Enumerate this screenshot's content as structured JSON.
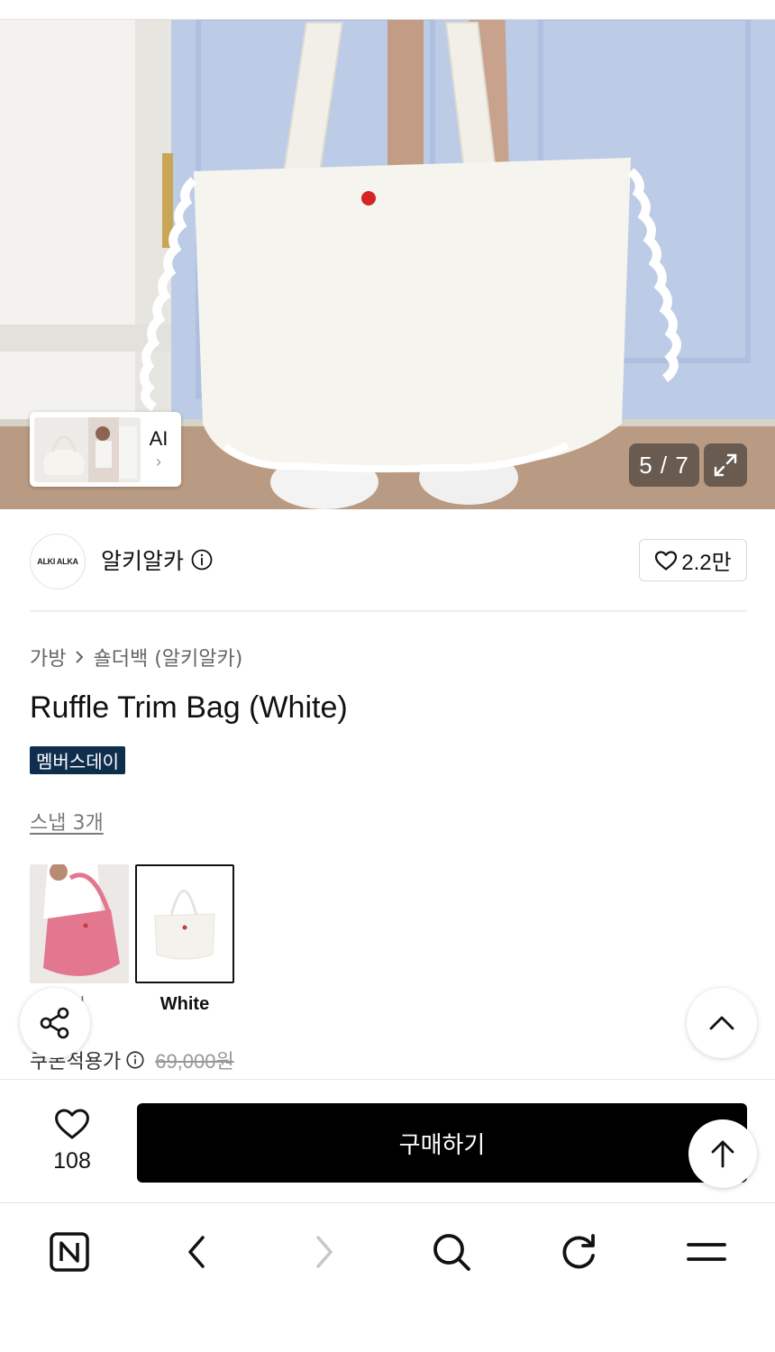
{
  "gallery": {
    "counter": "5 / 7",
    "thumb_label": "AI",
    "thumb_chevron": "›"
  },
  "brand": {
    "logo_text": "ALKI ALKA",
    "name": "알키알카",
    "likes": "2.2만"
  },
  "product": {
    "breadcrumb": [
      "가방",
      "숄더백 (알키알카)"
    ],
    "title": "Ruffle Trim Bag (White)",
    "badge": "멤버스데이",
    "snap_link": "스냅 3개",
    "options": [
      {
        "label": "Red",
        "visible_label": "d",
        "selected": false
      },
      {
        "label": "White",
        "selected": true
      }
    ],
    "price_label": "쿠폰적용가",
    "original_price": "69,000원"
  },
  "buy_bar": {
    "wish_count": "108",
    "buy_label": "구매하기"
  },
  "browser_nav": {
    "items": [
      "naver-home-icon",
      "back-icon",
      "forward-icon",
      "search-icon",
      "reload-icon",
      "menu-icon"
    ]
  },
  "colors": {
    "badge_bg": "#0f2e4e",
    "buy_button_bg": "#000000",
    "option_red": "#e2778f"
  }
}
